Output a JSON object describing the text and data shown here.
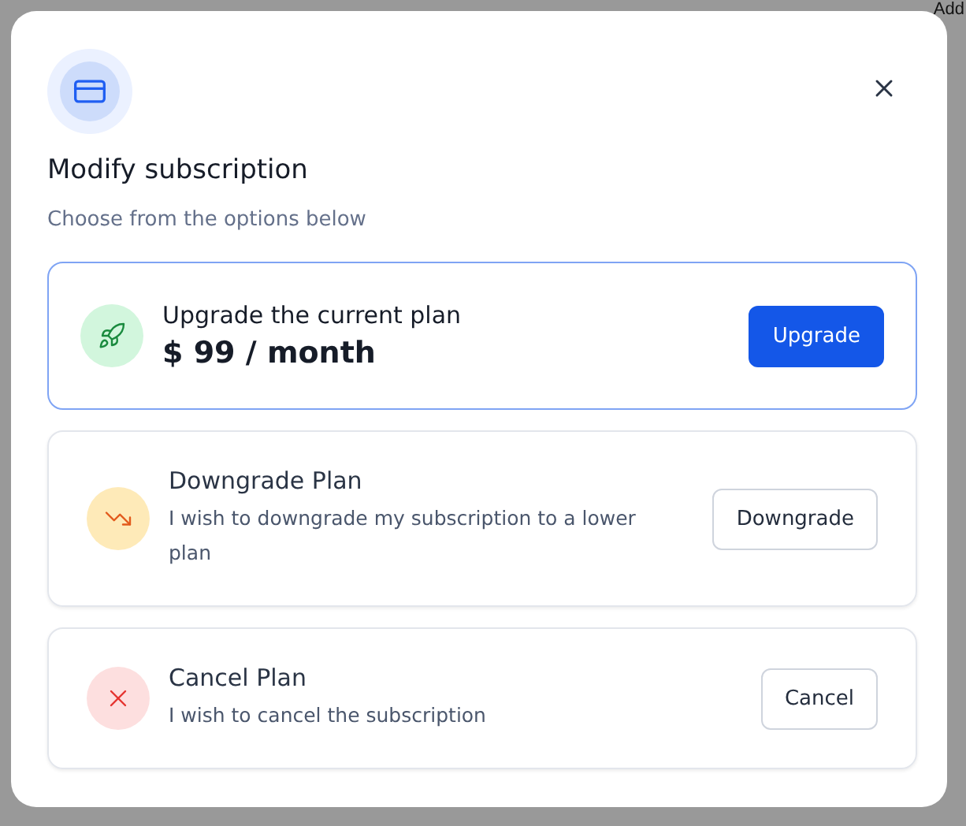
{
  "background": {
    "text": "Add"
  },
  "dialog": {
    "title": "Modify subscription",
    "subtitle": "Choose from the options below",
    "options": [
      {
        "kind": "price",
        "title": "Upgrade the current plan",
        "price": "$ 99 / month",
        "button": "Upgrade",
        "selected": true
      },
      {
        "kind": "description",
        "title": "Downgrade Plan",
        "description": "I wish to downgrade my subscription to a lower plan",
        "button": "Downgrade",
        "selected": false
      },
      {
        "kind": "description",
        "title": "Cancel Plan",
        "description": "I wish to cancel the subscription",
        "button": "Cancel",
        "selected": false
      }
    ]
  }
}
